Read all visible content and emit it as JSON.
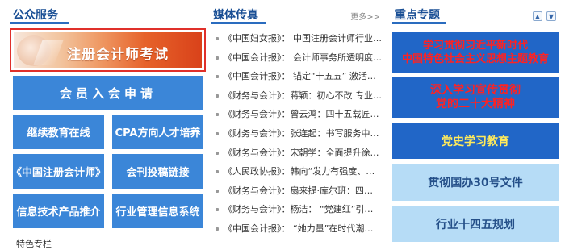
{
  "public_services": {
    "title": "公众服务",
    "banner_label": "注册会计师考试",
    "member_button": "会员入会申请",
    "grid_buttons": [
      {
        "label": "继续教育在线"
      },
      {
        "label": "CPA方向人才培养"
      },
      {
        "label": "《中国注册会计师》"
      },
      {
        "label": "会刊投稿链接"
      },
      {
        "label": "信息技术产品推介"
      },
      {
        "label": "行业管理信息系统"
      }
    ],
    "cut_off_heading": "特色专栏"
  },
  "media": {
    "title": "媒体传真",
    "more_label": "更多>>",
    "news": [
      {
        "text": "《中国妇女报》： 中国注册会计师行业…"
      },
      {
        "text": "《中国会计报》： 会计师事务所透明度…"
      },
      {
        "text": "《中国会计报》： 锚定“十五五” 激活…"
      },
      {
        "text": "《财务与会计》：蒋颖：初心不改 专业…"
      },
      {
        "text": "《财务与会计》：曾云鸿：四十五载匠…"
      },
      {
        "text": "《财务与会计》：张连起：书写服务中…"
      },
      {
        "text": "《财务与会计》：宋朝学：全面提升徐…"
      },
      {
        "text": "《人民政协报》：韩向“发力有强度、…"
      },
      {
        "text": "《财务与会计》：扇来提·库尔班：四…"
      },
      {
        "text": "《财务与会计》：杨洁： “党建红”引…"
      },
      {
        "text": "《中国会计报》： “她力量”在时代潮…"
      }
    ]
  },
  "topics": {
    "title": "重点专题",
    "items": [
      {
        "line1": "学习贯彻习近平新时代",
        "line2": "中国特色社会主义思想主题教育"
      },
      {
        "line1": "深入学习宣传贯彻",
        "line2": "党的二十大精神"
      },
      {
        "line1": "党史学习教育"
      },
      {
        "line1": "贯彻国办30号文件"
      },
      {
        "line1": "行业十四五规划"
      }
    ]
  }
}
